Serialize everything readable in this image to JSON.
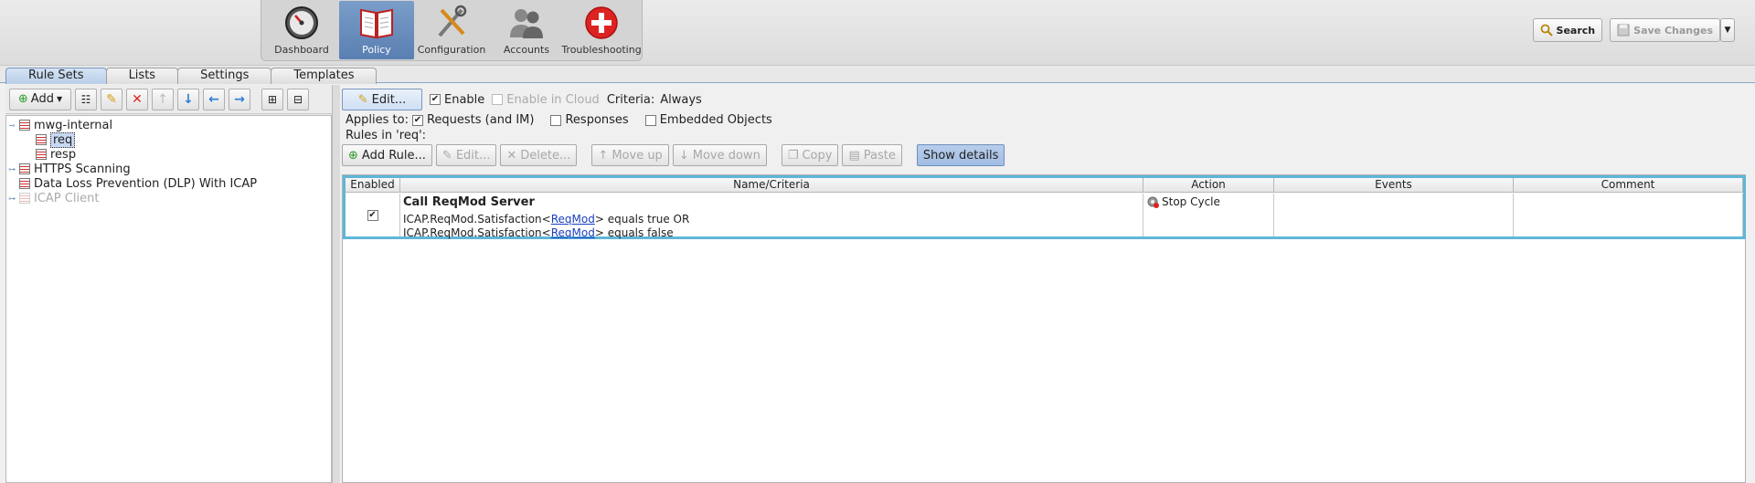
{
  "nav": {
    "items": [
      {
        "label": "Dashboard",
        "icon": "gauge-icon"
      },
      {
        "label": "Policy",
        "icon": "book-icon",
        "active": true
      },
      {
        "label": "Configuration",
        "icon": "tools-icon"
      },
      {
        "label": "Accounts",
        "icon": "users-icon"
      },
      {
        "label": "Troubleshooting",
        "icon": "first-aid-icon"
      }
    ]
  },
  "toolbar": {
    "search_label": "Search",
    "save_label": "Save Changes"
  },
  "tabs": [
    "Rule Sets",
    "Lists",
    "Settings",
    "Templates"
  ],
  "left_tools": {
    "add_label": "Add"
  },
  "tree": {
    "items": [
      {
        "label": "mwg-internal",
        "level": 0,
        "expander": "collapse"
      },
      {
        "label": "req",
        "level": 1,
        "selected": true
      },
      {
        "label": "resp",
        "level": 1
      },
      {
        "label": "HTTPS Scanning",
        "level": 0,
        "expander": "expand"
      },
      {
        "label": "Data Loss Prevention (DLP) With ICAP",
        "level": 0
      },
      {
        "label": "ICAP Client",
        "level": 0,
        "expander": "expand",
        "disabled": true
      }
    ]
  },
  "ruleset": {
    "edit_label": "Edit...",
    "enable_label": "Enable",
    "enable_cloud_label": "Enable in Cloud",
    "criteria_label": "Criteria:",
    "criteria_value": "Always",
    "applies_to_label": "Applies to:",
    "requests_label": "Requests (and IM)",
    "responses_label": "Responses",
    "embedded_label": "Embedded Objects",
    "rules_in_label": "Rules in 'req':"
  },
  "rule_tools": {
    "add_rule": "Add Rule...",
    "edit": "Edit...",
    "delete": "Delete...",
    "move_up": "Move up",
    "move_down": "Move down",
    "copy": "Copy",
    "paste": "Paste",
    "show_details": "Show details"
  },
  "table": {
    "headers": {
      "enabled": "Enabled",
      "name": "Name/Criteria",
      "action": "Action",
      "events": "Events",
      "comment": "Comment"
    },
    "rows": [
      {
        "enabled": true,
        "name": "Call ReqMod Server",
        "crit1_pre": "ICAP.ReqMod.Satisfaction<",
        "crit1_link": "ReqMod",
        "crit1_post": "> equals true OR",
        "crit2_pre": "ICAP.ReqMod.Satisfaction<",
        "crit2_link": "ReqMod",
        "crit2_post": "> equals false",
        "action": "Stop Cycle",
        "events": "",
        "comment": ""
      }
    ]
  }
}
